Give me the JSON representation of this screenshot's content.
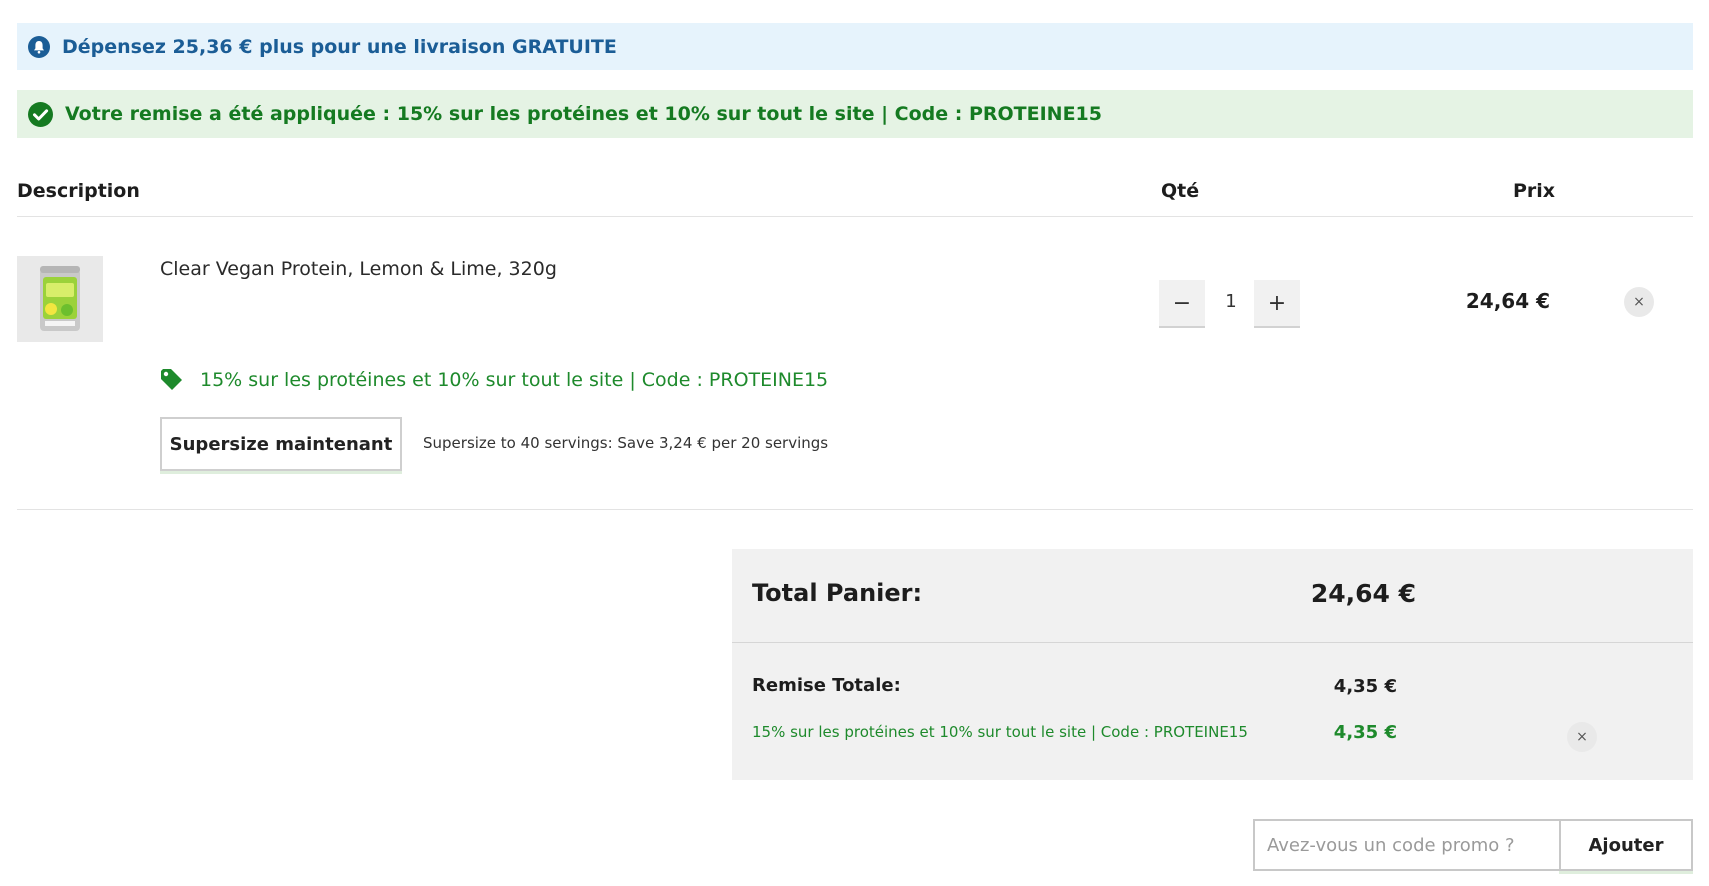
{
  "banners": {
    "info": "Dépensez 25,36 € plus pour une livraison GRATUITE",
    "discount_applied": "Votre remise a été appliquée : 15% sur les protéines et 10% sur tout le site | Code : PROTEINE15"
  },
  "table_header": {
    "description": "Description",
    "qty": "Qté",
    "price": "Prix"
  },
  "item": {
    "name": "Clear Vegan Protein, Lemon & Lime, 320g",
    "quantity": "1",
    "minus": "−",
    "plus": "+",
    "price": "24,64 €",
    "remove": "×",
    "promo": "15% sur les protéines et 10% sur tout le site | Code : PROTEINE15",
    "supersize_button": "Supersize maintenant",
    "supersize_text": "Supersize to 40 servings: Save 3,24 € per 20 servings"
  },
  "totals": {
    "total_label": "Total Panier:",
    "total_value": "24,64 €",
    "discount_label": "Remise Totale:",
    "discount_value": "4,35 €",
    "discount_code_text": "15% sur les protéines et 10% sur tout le site | Code : PROTEINE15",
    "discount_code_value": "4,35 €",
    "discount_remove": "×"
  },
  "promo_form": {
    "placeholder": "Avez-vous un code promo ?",
    "button": "Ajouter"
  },
  "colors": {
    "info_bg": "#e6f3fc",
    "info_text": "#1b5d96",
    "success_bg": "#e5f3e4",
    "success_text": "#157a21",
    "panel_bg": "#f1f1f1"
  },
  "icons": {
    "info": "bell-icon",
    "success": "check-circle-icon",
    "promo": "tag-icon",
    "remove": "close-icon"
  }
}
